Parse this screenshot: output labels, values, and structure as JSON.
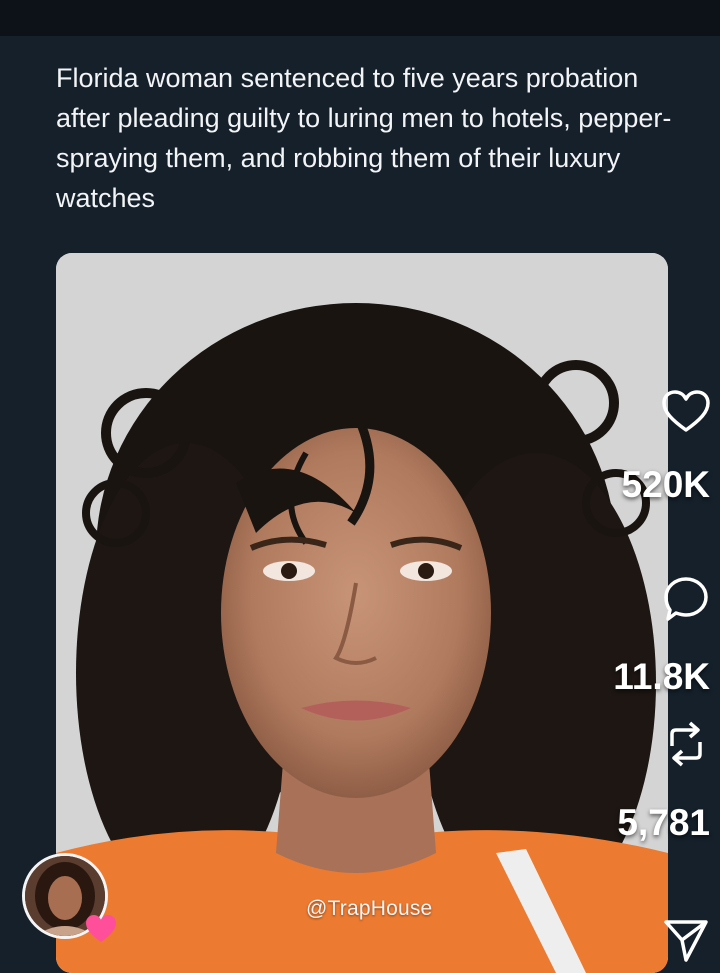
{
  "post": {
    "text": "Florida woman sentenced to five years probation after pleading guilty to luring men to hotels, pepper-spraying them, and robbing them of their luxury watches"
  },
  "media": {
    "watermark": "@TrapHouse"
  },
  "actions": {
    "like": {
      "icon": "heart-outline-icon",
      "count": "520K"
    },
    "comment": {
      "icon": "speech-bubble-icon",
      "count": "11.8K"
    },
    "repost": {
      "icon": "repost-arrows-icon",
      "count": "5,781"
    },
    "share": {
      "icon": "paper-plane-icon"
    }
  },
  "colors": {
    "background": "#15202b",
    "text": "#e7e9ea",
    "heart_badge": "#ff4f9a"
  }
}
